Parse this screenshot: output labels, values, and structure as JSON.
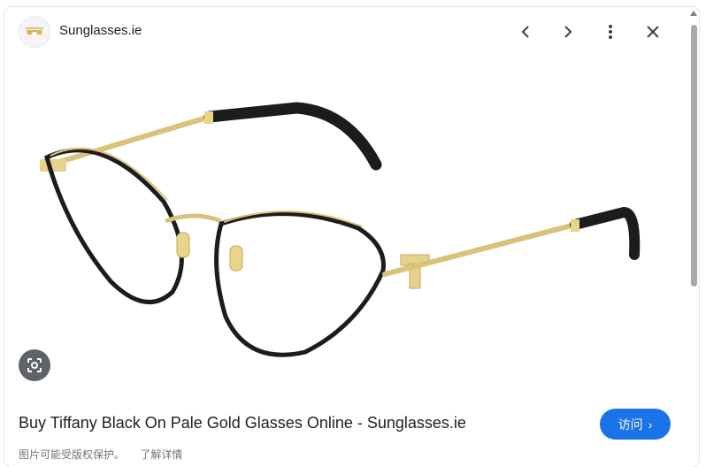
{
  "header": {
    "site_name": "Sunglasses.ie",
    "favicon_icon": "sunglasses-logo-icon",
    "prev_icon": "chevron-left-icon",
    "next_icon": "chevron-right-icon",
    "more_icon": "more-vert-icon",
    "close_icon": "close-icon"
  },
  "image": {
    "subject": "black-and-gold-cat-eye-eyeglasses",
    "lens_icon": "google-lens-icon"
  },
  "result": {
    "title": "Buy Tiffany Black On Pale Gold Glasses Online - Sunglasses.ie",
    "visit_label": "访问",
    "visit_icon": "chevron-right-icon"
  },
  "footer": {
    "copyright_note": "图片可能受版权保护。",
    "learn_more": "了解详情"
  },
  "colors": {
    "accent": "#1a73e8",
    "text": "#202124",
    "muted": "#70757a",
    "frame_gold": "#d9c27a",
    "frame_black": "#1c1c1c"
  }
}
